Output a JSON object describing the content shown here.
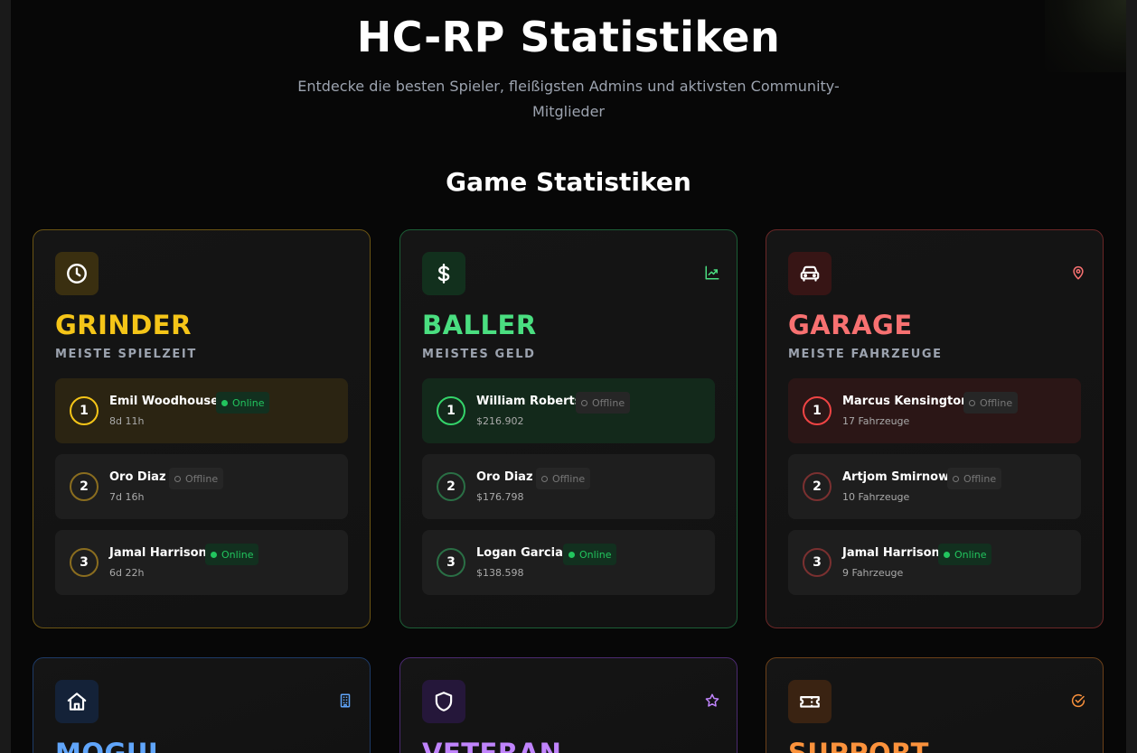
{
  "header": {
    "title": "HC-RP Statistiken",
    "subtitle": "Entdecke die besten Spieler, fleißigsten Admins und aktivsten Community-Mitglieder"
  },
  "section": {
    "title": "Game Statistiken"
  },
  "cards": [
    {
      "title": "GRINDER",
      "subtitle": "MEISTE SPIELZEIT",
      "icon": "clock-icon",
      "accent": "#f5c518",
      "entries": [
        {
          "rank": "1",
          "name": "Emil Woodhouse",
          "value": "8d 11h",
          "status": "Online"
        },
        {
          "rank": "2",
          "name": "Oro Diaz",
          "value": "7d 16h",
          "status": "Offline"
        },
        {
          "rank": "3",
          "name": "Jamal Harrison",
          "value": "6d 22h",
          "status": "Online"
        }
      ]
    },
    {
      "title": "BALLER",
      "subtitle": "MEISTES GELD",
      "icon": "dollar-icon",
      "corner_icon": "trending-chart-icon",
      "accent": "#4ade80",
      "entries": [
        {
          "rank": "1",
          "name": "William Roberts",
          "value": "$216.902",
          "status": "Offline"
        },
        {
          "rank": "2",
          "name": "Oro Diaz",
          "value": "$176.798",
          "status": "Offline"
        },
        {
          "rank": "3",
          "name": "Logan Garcia",
          "value": "$138.598",
          "status": "Online"
        }
      ]
    },
    {
      "title": "GARAGE",
      "subtitle": "MEISTE FAHRZEUGE",
      "icon": "car-icon",
      "corner_icon": "map-pin-icon",
      "accent": "#f87171",
      "entries": [
        {
          "rank": "1",
          "name": "Marcus Kensington",
          "value": "17 Fahrzeuge",
          "status": "Offline"
        },
        {
          "rank": "2",
          "name": "Artjom Smirnow",
          "value": "10 Fahrzeuge",
          "status": "Offline"
        },
        {
          "rank": "3",
          "name": "Jamal Harrison",
          "value": "9 Fahrzeuge",
          "status": "Online"
        }
      ]
    },
    {
      "title": "MOGUL",
      "icon": "house-icon",
      "corner_icon": "building-icon",
      "accent": "#60a5fa"
    },
    {
      "title": "VETERAN",
      "icon": "shield-icon",
      "corner_icon": "star-icon",
      "accent": "#c084fc"
    },
    {
      "title": "SUPPORT",
      "icon": "ticket-icon",
      "corner_icon": "check-circle-icon",
      "accent": "#fb923c"
    }
  ]
}
